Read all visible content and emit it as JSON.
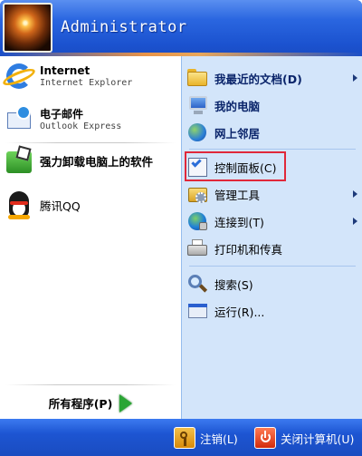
{
  "header": {
    "user_name": "Administrator"
  },
  "left": {
    "pinned": [
      {
        "title": "Internet",
        "subtitle": "Internet Explorer",
        "icon": "internet-explorer-icon"
      },
      {
        "title": "电子邮件",
        "subtitle": "Outlook Express",
        "icon": "outlook-express-icon"
      }
    ],
    "recent": [
      {
        "title": "强力卸载电脑上的软件",
        "icon": "uninstaller-icon"
      },
      {
        "title": "腾讯QQ",
        "icon": "qq-penguin-icon"
      }
    ],
    "all_programs_label": "所有程序(P)"
  },
  "right": {
    "items": [
      {
        "label": "我最近的文档(D)",
        "icon": "folder-icon",
        "has_submenu": true
      },
      {
        "label": "我的电脑",
        "icon": "my-computer-icon",
        "has_submenu": false
      },
      {
        "label": "网上邻居",
        "icon": "network-icon",
        "has_submenu": false
      },
      {
        "label": "控制面板(C)",
        "icon": "control-panel-icon",
        "has_submenu": false,
        "highlighted": true
      },
      {
        "label": "管理工具",
        "icon": "admin-tools-icon",
        "has_submenu": true
      },
      {
        "label": "连接到(T)",
        "icon": "connect-to-icon",
        "has_submenu": true
      },
      {
        "label": "打印机和传真",
        "icon": "printer-icon",
        "has_submenu": false
      },
      {
        "label": "搜索(S)",
        "icon": "search-icon",
        "has_submenu": false
      },
      {
        "label": "运行(R)...",
        "icon": "run-icon",
        "has_submenu": false
      }
    ]
  },
  "footer": {
    "logoff_label": "注销(L)",
    "shutdown_label": "关闭计算机(U)"
  },
  "colors": {
    "header_blue": "#2a66e0",
    "right_pane": "#d3e5fa",
    "highlight_border": "#e0283a",
    "all_programs_arrow": "#2aa534"
  }
}
